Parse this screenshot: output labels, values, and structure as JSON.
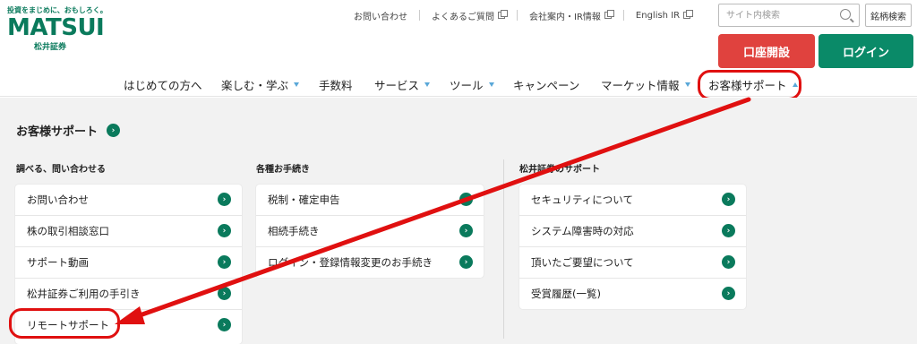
{
  "logo": {
    "tagline": "投資をまじめに、おもしろく。",
    "brand": "MATSUI",
    "company": "松井証券"
  },
  "top_links": [
    {
      "label": "お問い合わせ",
      "external": false
    },
    {
      "label": "よくあるご質問",
      "external": true
    },
    {
      "label": "会社案内・IR情報",
      "external": true
    },
    {
      "label": "English IR",
      "external": true
    }
  ],
  "search": {
    "placeholder": "サイト内検索",
    "value": ""
  },
  "stock_search_label": "銘柄検索",
  "open_account_label": "口座開設",
  "login_label": "ログイン",
  "global_nav": [
    {
      "label": "はじめての方へ",
      "dropdown": false
    },
    {
      "label": "楽しむ・学ぶ",
      "dropdown": true
    },
    {
      "label": "手数料",
      "dropdown": false
    },
    {
      "label": "サービス",
      "dropdown": true
    },
    {
      "label": "ツール",
      "dropdown": true
    },
    {
      "label": "キャンペーン",
      "dropdown": false
    },
    {
      "label": "マーケット情報",
      "dropdown": true
    },
    {
      "label": "お客様サポート",
      "dropdown": true,
      "active": true
    }
  ],
  "menu": {
    "title": "お客様サポート",
    "columns": [
      {
        "heading": "調べる、問い合わせる",
        "items": [
          "お問い合わせ",
          "株の取引相談窓口",
          "サポート動画",
          "松井証券ご利用の手引き",
          "リモートサポート"
        ]
      },
      {
        "heading": "各種お手続き",
        "items": [
          "税制・確定申告",
          "相続手続き",
          "ログイン・登録情報変更のお手続き"
        ]
      },
      {
        "heading": "松井証券のサポート",
        "items": [
          "セキュリティについて",
          "システム障害時の対応",
          "頂いたご要望について",
          "受賞履歴(一覧)"
        ]
      }
    ]
  },
  "colors": {
    "brand_green": "#0a7a5c",
    "login_green": "#0a8a68",
    "account_red": "#e0423e",
    "annotation_red": "#e01010",
    "dropdown_blue": "#5aa8d8"
  }
}
